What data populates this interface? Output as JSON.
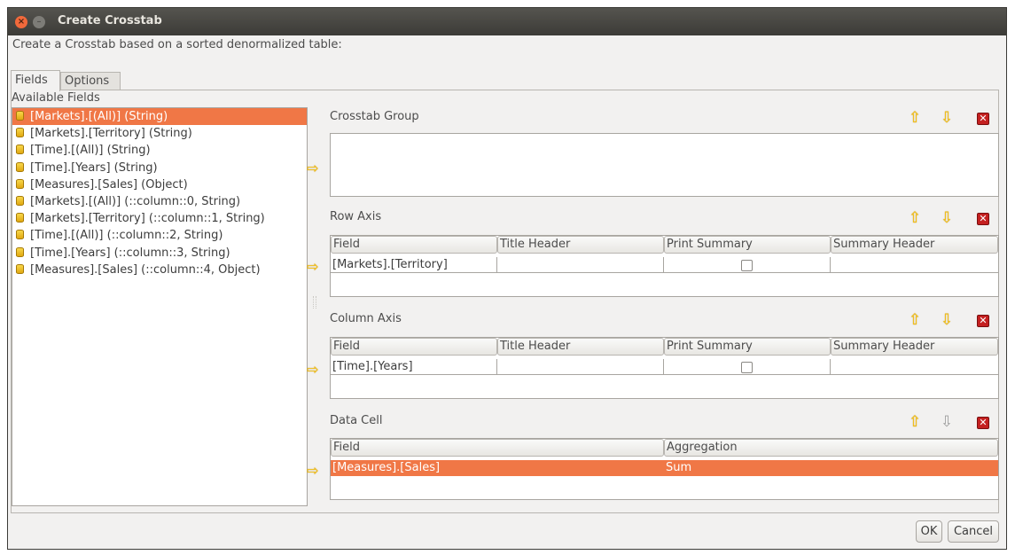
{
  "window": {
    "title": "Create Crosstab"
  },
  "dialog": {
    "description": "Create a Crosstab based on a sorted denormalized table:"
  },
  "tabs": [
    {
      "label": "Fields"
    },
    {
      "label": "Options"
    }
  ],
  "available_fields": {
    "label": "Available Fields",
    "items": [
      {
        "text": "[Markets].[(All)] (String)",
        "selected": true
      },
      {
        "text": "[Markets].[Territory] (String)"
      },
      {
        "text": "[Time].[(All)] (String)"
      },
      {
        "text": "[Time].[Years] (String)"
      },
      {
        "text": "[Measures].[Sales] (Object)"
      },
      {
        "text": "[Markets].[(All)] (::column::0, String)"
      },
      {
        "text": "[Markets].[Territory] (::column::1, String)"
      },
      {
        "text": "[Time].[(All)] (::column::2, String)"
      },
      {
        "text": "[Time].[Years] (::column::3, String)"
      },
      {
        "text": "[Measures].[Sales] (::column::4, Object)"
      }
    ]
  },
  "crosstab_group": {
    "title": "Crosstab Group"
  },
  "row_axis": {
    "title": "Row Axis",
    "headers": [
      "Field",
      "Title Header",
      "Print Summary",
      "Summary Header"
    ],
    "rows": [
      {
        "field": "[Markets].[Territory]",
        "title_header": "",
        "print_summary": false,
        "summary_header": ""
      }
    ]
  },
  "column_axis": {
    "title": "Column Axis",
    "headers": [
      "Field",
      "Title Header",
      "Print Summary",
      "Summary Header"
    ],
    "rows": [
      {
        "field": "[Time].[Years]",
        "title_header": "",
        "print_summary": false,
        "summary_header": ""
      }
    ]
  },
  "data_cell": {
    "title": "Data Cell",
    "headers": [
      "Field",
      "Aggregation"
    ],
    "rows": [
      {
        "field": "[Measures].[Sales]",
        "aggregation": "Sum",
        "selected": true
      }
    ]
  },
  "buttons": {
    "ok": "OK",
    "cancel": "Cancel"
  },
  "colors": {
    "selection": "#f07746",
    "titlebar": "#3c3b37",
    "arrow": "#f6c213",
    "delete": "#c42020"
  },
  "icons": {
    "up": "arrow-up-icon",
    "down": "arrow-down-icon",
    "delete": "delete-icon",
    "add": "arrow-right-icon",
    "field": "database-field-icon"
  }
}
